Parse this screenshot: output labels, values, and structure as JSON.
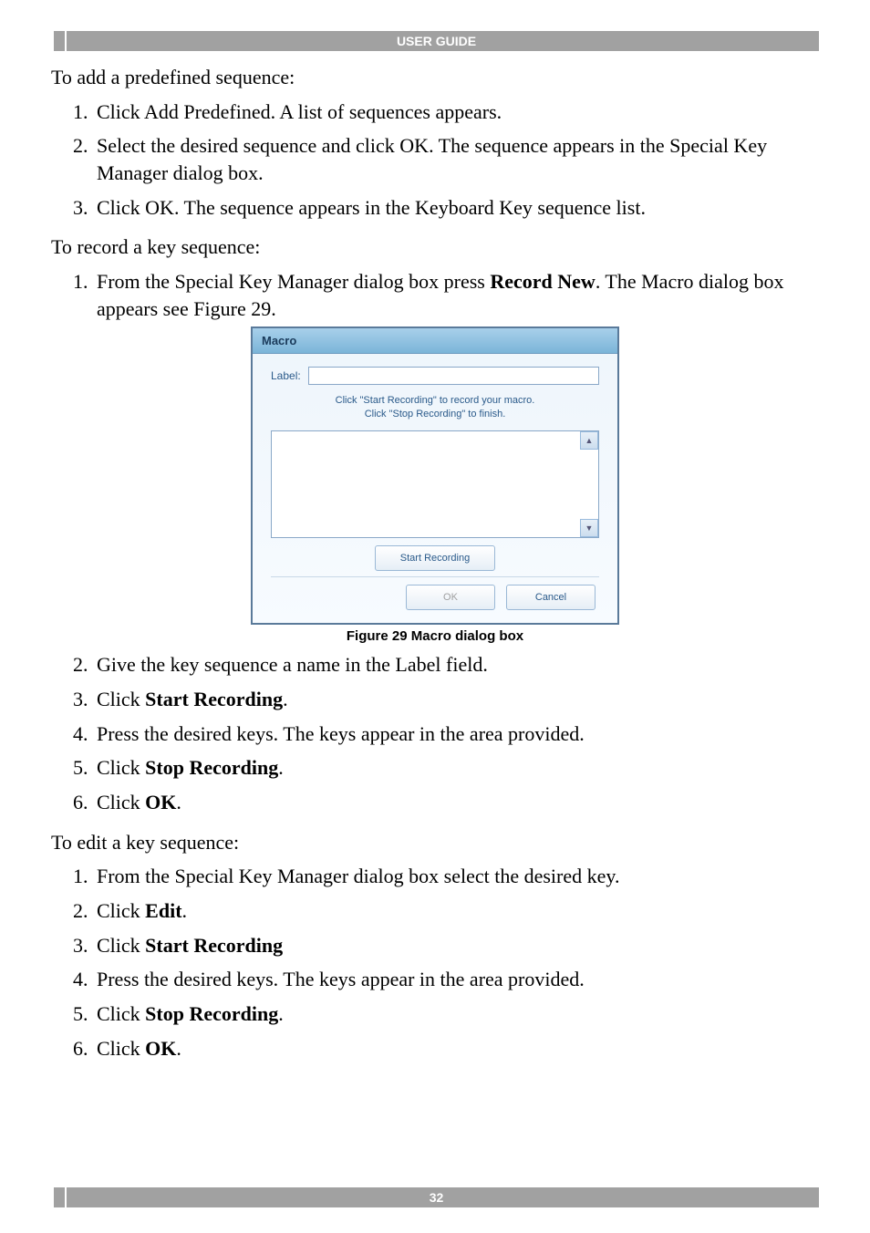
{
  "header": {
    "title": "USER GUIDE"
  },
  "footer": {
    "page": "32"
  },
  "intro1": "To add a predefined sequence:",
  "list1": [
    "Click Add Predefined. A list of sequences appears.",
    "Select the desired sequence and click OK. The sequence appears in the Special Key Manager dialog box.",
    "Click OK. The sequence appears in the Keyboard Key sequence list."
  ],
  "intro2": "To record a key sequence:",
  "list2": {
    "item1_a": "From the Special Key Manager dialog box press ",
    "item1_b": "Record New",
    "item1_c": ". The Macro dialog box appears see Figure 29."
  },
  "dialog": {
    "title": "Macro",
    "label": "Label:",
    "hint1": "Click \"Start Recording\" to record your macro.",
    "hint2": "Click \"Stop Recording\" to finish.",
    "start": "Start Recording",
    "ok": "OK",
    "cancel": "Cancel"
  },
  "figcaption": "Figure 29 Macro dialog box",
  "list3": {
    "i2": "Give the key sequence a name in the Label field.",
    "i3_a": "Click ",
    "i3_b": "Start Recording",
    "i3_c": ".",
    "i4": "Press the desired keys. The keys appear in the area provided.",
    "i5_a": "Click ",
    "i5_b": "Stop Recording",
    "i5_c": ".",
    "i6_a": "Click ",
    "i6_b": "OK",
    "i6_c": "."
  },
  "intro3": "To edit a key sequence:",
  "list4": {
    "i1": "From the Special Key Manager dialog box select the desired key.",
    "i2_a": "Click ",
    "i2_b": "Edit",
    "i2_c": ".",
    "i3_a": "Click ",
    "i3_b": "Start Recording",
    "i4": "Press the desired keys. The keys appear in the area provided.",
    "i5_a": "Click ",
    "i5_b": "Stop Recording",
    "i5_c": ".",
    "i6_a": "Click ",
    "i6_b": "OK",
    "i6_c": "."
  }
}
